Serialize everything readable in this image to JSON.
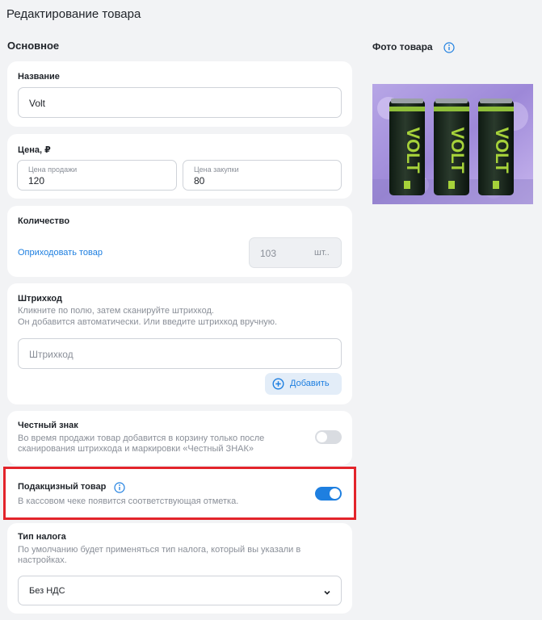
{
  "page": {
    "title": "Редактирование товара"
  },
  "sections": {
    "main_title": "Основное",
    "photo_title": "Фото товара"
  },
  "name": {
    "label": "Название",
    "value": "Volt"
  },
  "price": {
    "label": "Цена, ₽",
    "sale_label": "Цена продажи",
    "sale_value": "120",
    "purchase_label": "Цена закупки",
    "purchase_value": "80"
  },
  "quantity": {
    "label": "Количество",
    "receive_link": "Оприходовать товар",
    "value": "103",
    "unit": "шт.."
  },
  "barcode": {
    "label": "Штрихкод",
    "hint_line1": "Кликните по полю, затем сканируйте штрихкод.",
    "hint_line2": "Он добавится автоматически. Или введите штрихкод вручную.",
    "placeholder": "Штрихкод",
    "add_button": "Добавить"
  },
  "honest_sign": {
    "label": "Честный знак",
    "hint_line1": "Во время продажи товар добавится в корзину только после",
    "hint_line2": "сканирования штрихкода и маркировки «Честный ЗНАК»",
    "enabled": false
  },
  "excise": {
    "label": "Подакцизный товар",
    "hint": "В кассовом чеке появится соответствующая отметка.",
    "enabled": true
  },
  "tax": {
    "label": "Тип налога",
    "hint_line1": "По умолчанию будет применяться тип налога, который вы  указали в",
    "hint_line2": "настройках.",
    "selected": "Без НДС"
  },
  "colors": {
    "accent": "#1e7fe0",
    "highlight_border": "#e3242b",
    "toggle_off": "#d9dce1"
  },
  "photo": {
    "brand_text": "VOLT"
  }
}
